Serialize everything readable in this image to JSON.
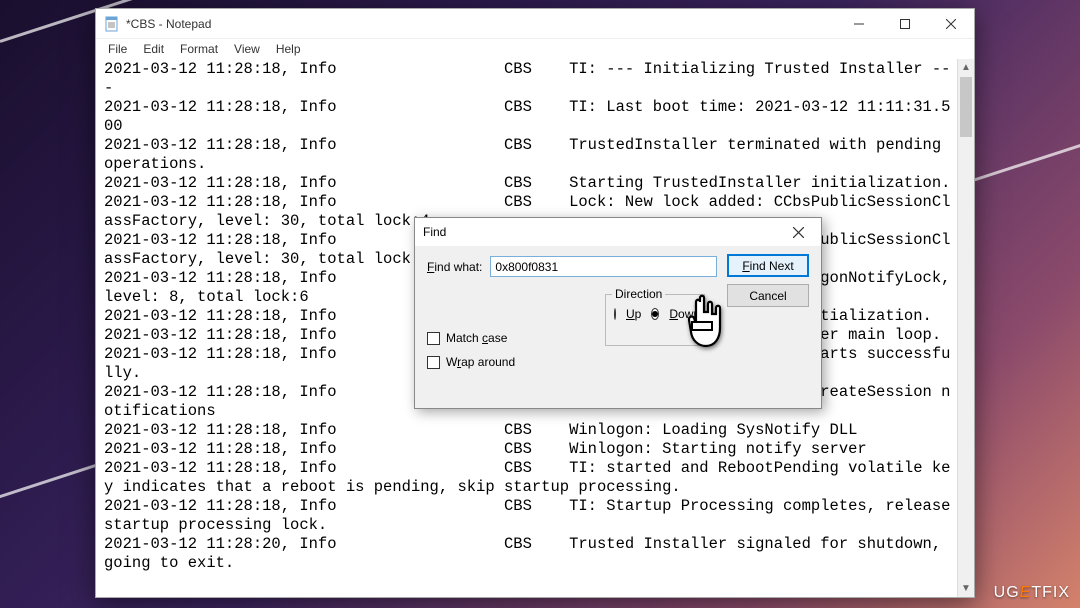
{
  "window": {
    "title": "*CBS - Notepad",
    "menu": {
      "file": "File",
      "edit": "Edit",
      "format": "Format",
      "view": "View",
      "help": "Help"
    }
  },
  "log": {
    "text": "2021-03-12 11:28:18, Info                  CBS    TI: --- Initializing Trusted Installer ---\n2021-03-12 11:28:18, Info                  CBS    TI: Last boot time: 2021-03-12 11:11:31.500\n2021-03-12 11:28:18, Info                  CBS    TrustedInstaller terminated with pending operations.\n2021-03-12 11:28:18, Info                  CBS    Starting TrustedInstaller initialization.\n2021-03-12 11:28:18, Info                  CBS    Lock: New lock added: CCbsPublicSessionClassFactory, level: 30, total lock:4\n2021-03-12 11:28:18, Info                  CBS    Lock: New lock added: CCbsPublicSessionClassFactory, level: 30, total lock:5\n2021-03-12 11:28:18, Info                  CBS    Lock: New lock added: WinlogonNotifyLock, level: 8, total lock:6\n2021-03-12 11:28:18, Info                  CBS    Ending TrustedInstaller initialization.\n2021-03-12 11:28:18, Info                  CBS    Starting the TrustedInstaller main loop.\n2021-03-12 11:28:18, Info                  CBS    TrustedInstaller service starts successfully.\n2021-03-12 11:28:18, Info                  CBS    Winlogon: Registering for CreateSession notifications\n2021-03-12 11:28:18, Info                  CBS    Winlogon: Loading SysNotify DLL\n2021-03-12 11:28:18, Info                  CBS    Winlogon: Starting notify server\n2021-03-12 11:28:18, Info                  CBS    TI: started and RebootPending volatile key indicates that a reboot is pending, skip startup processing.\n2021-03-12 11:28:18, Info                  CBS    TI: Startup Processing completes, release startup processing lock.\n2021-03-12 11:28:20, Info                  CBS    Trusted Installer signaled for shutdown, going to exit."
  },
  "find": {
    "title": "Find",
    "find_what_label": "Find what:",
    "find_what_value": "0x800f0831",
    "find_next": "Find Next",
    "cancel": "Cancel",
    "match_case": "Match case",
    "wrap_around": "Wrap around",
    "direction_label": "Direction",
    "up_label": "Up",
    "down_label": "Down",
    "direction_selected": "down"
  },
  "watermark": {
    "text_pre": "UG",
    "text_mid": "E",
    "text_post": "TFIX"
  }
}
